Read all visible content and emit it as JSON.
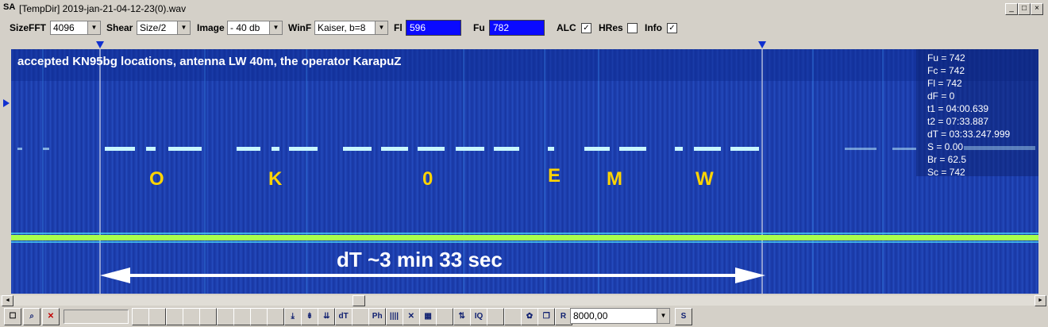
{
  "window": {
    "app_icon": "SA",
    "title": "[TempDir] 2019-jan-21-04-12-23(0).wav",
    "minimize": "_",
    "maximize": "□",
    "close": "×"
  },
  "toolbar": {
    "sizefft_label": "SizeFFT",
    "sizefft_value": "4096",
    "shear_label": "Shear",
    "shear_value": "Size/2",
    "image_label": "Image",
    "image_value": "- 40 db",
    "winf_label": "WinF",
    "winf_value": "Kaiser, b=8",
    "fl_label": "Fl",
    "fl_value": "596",
    "fu_label": "Fu",
    "fu_value": "782",
    "alc_label": "ALC",
    "alc_checked": "✓",
    "hres_label": "HRes",
    "hres_checked": "",
    "info_label": "Info",
    "info_checked": "✓"
  },
  "spectrogram": {
    "caption": "accepted KN95bg locations, antenna LW 40m, the operator KarapuZ",
    "letters": [
      "O",
      "K",
      "0",
      "E",
      "M",
      "W"
    ],
    "dt_annotation": "dT ~3 min 33 sec",
    "stats": [
      "Fu = 742",
      "Fc = 742",
      "Fl = 742",
      "dF = 0",
      "t1 = 04:00.639",
      "t2 = 07:33.887",
      "dT = 03:33.247.999",
      "S = 0.00",
      "Br = 62.5",
      "Sc = 742"
    ],
    "colors": {
      "background": "#1d3fae",
      "signal": "#c8f7ff",
      "letters": "#ffd400",
      "carrier": "#a8ff4d"
    }
  },
  "scrollbar": {
    "left": "◄",
    "right": "►"
  },
  "bottom": {
    "tool_icons": [
      "zoom-icon",
      "crosshair-icon",
      "stop-icon",
      "speaker-icon",
      "square-icon",
      "triangle-icon",
      "triangle-icon",
      "triangle-icon",
      "triangle-icon",
      "down-icon",
      "down2-icon",
      "down3-icon",
      "dt-icon",
      "blank-icon",
      "ph-icon",
      "bars-icon",
      "x-icon",
      "grid-icon",
      "blank2-icon",
      "arrows-icon",
      "iq-icon",
      "blank3-icon",
      "blank4-icon",
      "gear-icon",
      "pages-icon",
      "r-icon"
    ],
    "tool_labels": [
      "",
      "",
      "",
      "",
      "",
      "",
      "",
      "",
      "",
      "⤓",
      "⇟",
      "⇊",
      "dT",
      "",
      "Ph",
      "||||",
      "✕",
      "▦",
      "",
      "⇅",
      "IQ",
      "",
      "",
      "✿",
      "❐",
      "R"
    ],
    "freq_value": "8000,00",
    "s_button": "S"
  }
}
